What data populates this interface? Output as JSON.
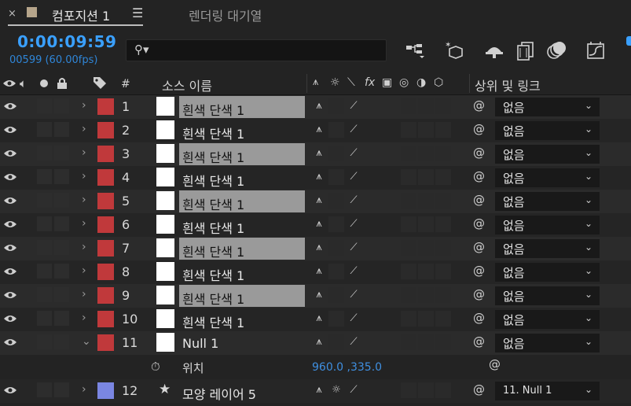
{
  "tabs": {
    "close_glyph": "×",
    "active_title": "컴포지션 1",
    "menu_glyph": "☰",
    "second_title": "렌더링 대기열"
  },
  "time": {
    "timecode": "0:00:09:59",
    "frames": "00599 (60.00fps)"
  },
  "search": {
    "icon": "search-icon",
    "glyph": "⚲▾"
  },
  "toolbar_icons": [
    "composition-flowchart-icon",
    "draft-3d-icon",
    "shy-layers-icon",
    "frame-blending-icon",
    "motion-blur-icon",
    "graph-editor-icon"
  ],
  "header": {
    "hash": "#",
    "source_name": "소스 이름",
    "parent_link": "상위 및 링크",
    "switch_glyphs": [
      "⚲",
      "☼",
      "⟍",
      "fx",
      "▣",
      "◎",
      "◑",
      "⬡"
    ]
  },
  "colors": {
    "red_label": "#c0393b",
    "blue_label": "#7a86e2",
    "selected_row": "#9a9a9a",
    "accent_blue": "#3aa0ff"
  },
  "layers": [
    {
      "num": "1",
      "name": "흰색 단색 1",
      "parent": "없음",
      "selected": true,
      "label": "red",
      "expanded": false
    },
    {
      "num": "2",
      "name": "흰색 단색 1",
      "parent": "없음",
      "selected": false,
      "label": "red",
      "expanded": false
    },
    {
      "num": "3",
      "name": "흰색 단색 1",
      "parent": "없음",
      "selected": true,
      "label": "red",
      "expanded": false
    },
    {
      "num": "4",
      "name": "흰색 단색 1",
      "parent": "없음",
      "selected": false,
      "label": "red",
      "expanded": false
    },
    {
      "num": "5",
      "name": "흰색 단색 1",
      "parent": "없음",
      "selected": true,
      "label": "red",
      "expanded": false
    },
    {
      "num": "6",
      "name": "흰색 단색 1",
      "parent": "없음",
      "selected": false,
      "label": "red",
      "expanded": false
    },
    {
      "num": "7",
      "name": "흰색 단색 1",
      "parent": "없음",
      "selected": true,
      "label": "red",
      "expanded": false
    },
    {
      "num": "8",
      "name": "흰색 단색 1",
      "parent": "없음",
      "selected": false,
      "label": "red",
      "expanded": false
    },
    {
      "num": "9",
      "name": "흰색 단색 1",
      "parent": "없음",
      "selected": true,
      "label": "red",
      "expanded": false
    },
    {
      "num": "10",
      "name": "흰색 단색 1",
      "parent": "없음",
      "selected": false,
      "label": "red",
      "expanded": false
    },
    {
      "num": "11",
      "name": "Null 1",
      "parent": "없음",
      "selected": false,
      "label": "red",
      "expanded": true
    }
  ],
  "property": {
    "name": "위치",
    "value": "960.0 ,335.0"
  },
  "shape_layer": {
    "num": "12",
    "name": "모양 레이어 5",
    "parent": "11. Null 1"
  }
}
